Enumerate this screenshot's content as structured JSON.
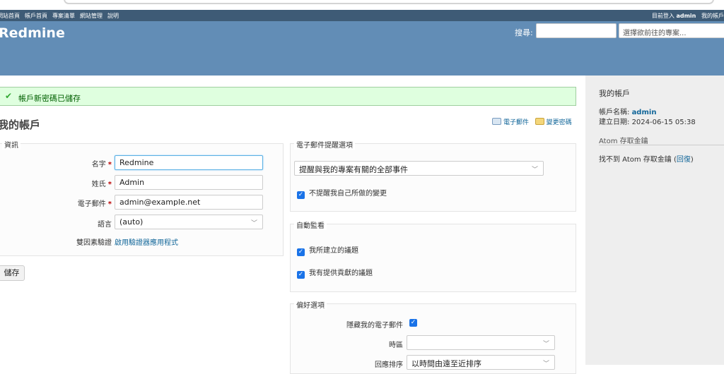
{
  "topmenu": {
    "items": [
      "網站首頁",
      "帳戶首頁",
      "專案清單",
      "網站管理",
      "說明"
    ],
    "logged_in_label": "目前登入",
    "logged_in_user": "admin",
    "my_account": "我的帳戶"
  },
  "header": {
    "title": "Redmine",
    "search_label": "搜尋:",
    "jump_placeholder": "選擇欲前往的專案..."
  },
  "flash": {
    "text": "帳戶新密碼已儲存"
  },
  "page": {
    "title": "我的帳戶"
  },
  "contextual": {
    "email": "電子郵件",
    "change_password": "變更密碼"
  },
  "info": {
    "legend": "資訊",
    "firstname_label": "名字",
    "firstname_value": "Redmine",
    "lastname_label": "姓氏",
    "lastname_value": "Admin",
    "mail_label": "電子郵件",
    "mail_value": "admin@example.net",
    "language_label": "語言",
    "language_value": "(auto)",
    "twofa_label": "雙因素驗證",
    "twofa_link": "啟用驗證器應用程式"
  },
  "save_button": "儲存",
  "notifications": {
    "legend": "電子郵件提醒選項",
    "select_value": "提醒與我的專案有關的全部事件",
    "no_self_notified": "不提醒我自己所做的變更"
  },
  "auto_watch": {
    "legend": "自動監看",
    "created": "我所建立的議題",
    "contributed": "我有提供貢獻的議題"
  },
  "preferences": {
    "legend": "偏好選項",
    "hide_mail": "隱藏我的電子郵件",
    "timezone": "時區",
    "timezone_value": "",
    "comments_order": "回應排序",
    "comments_order_value": "以時間由遠至近排序"
  },
  "sidebar": {
    "title": "我的帳戶",
    "login_label": "帳戶名稱:",
    "login_value": "admin",
    "created_label": "建立日期:",
    "created_value": "2024-06-15 05:38",
    "atom_title": "Atom 存取金鑰",
    "atom_text": "找不到 Atom 存取金鑰 (",
    "atom_link": "回復",
    "atom_close": ")"
  },
  "colors": {
    "header": "#628db6",
    "topmenu": "#3e5b76",
    "link": "#169",
    "flash_bg": "#dfffdf"
  }
}
